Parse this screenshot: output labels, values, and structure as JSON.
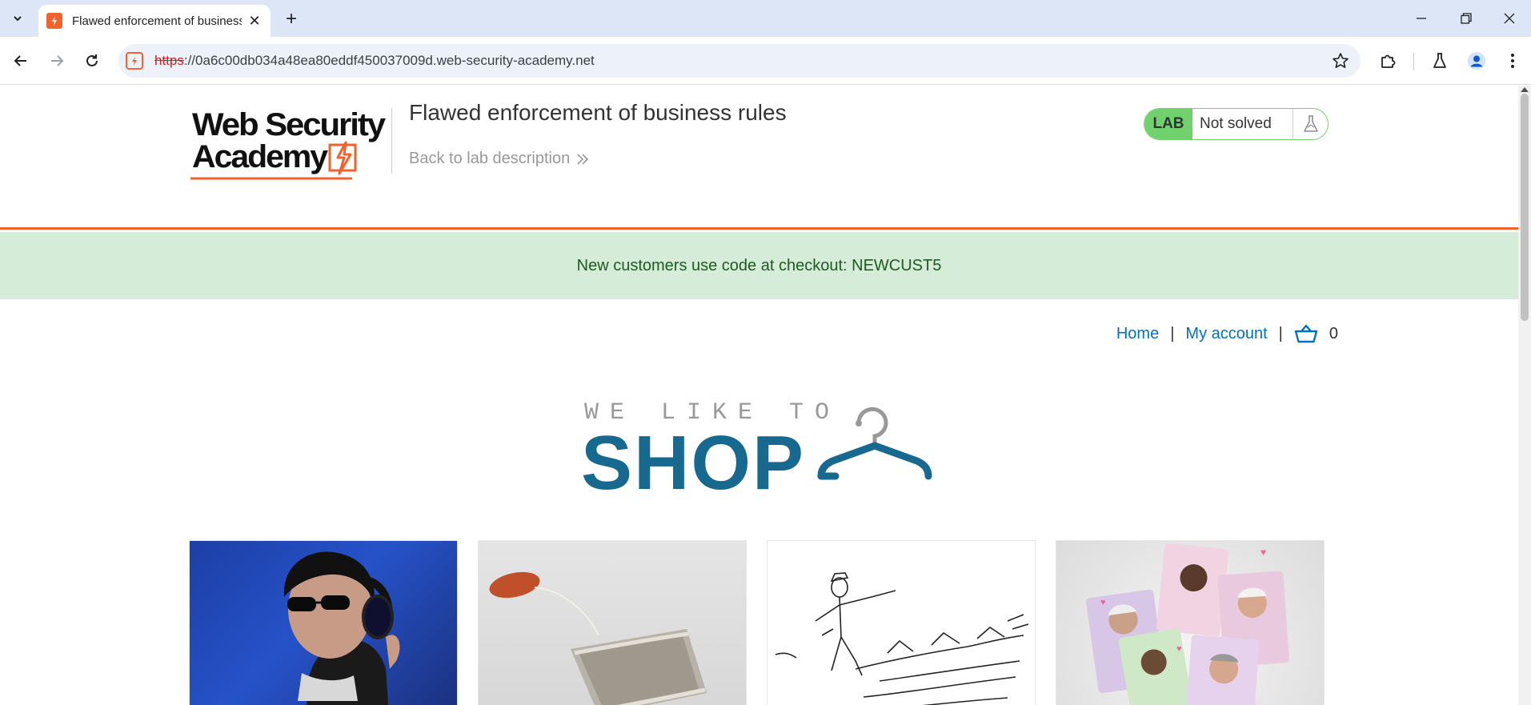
{
  "browser": {
    "tab_title": "Flawed enforcement of business rules",
    "url_scheme": "https",
    "url_rest": "://0a6c00db034a48ea80eddf450037009d.web-security-academy.net"
  },
  "header": {
    "logo_text_line1": "Web Security",
    "logo_text_line2": "Academy",
    "lab_title": "Flawed enforcement of business rules",
    "back_link": "Back to lab description",
    "status_badge": "LAB",
    "status_text": "Not solved"
  },
  "notice": {
    "text": "New customers use code at checkout: NEWCUST5"
  },
  "nav": {
    "home": "Home",
    "separator": "|",
    "my_account": "My account",
    "cart_count": "0"
  },
  "banner": {
    "tagline": "WE LIKE TO",
    "headline": "SHOP"
  },
  "colors": {
    "brand_orange": "#f0632d",
    "lab_green": "#70d16d",
    "notice_bg": "#d4ecd8",
    "link_blue": "#0071bc",
    "shop_blue": "#18698f"
  },
  "products": [
    {
      "image": "woman-with-headphones"
    },
    {
      "image": "tea-bag"
    },
    {
      "image": "line-drawing-walking-figure"
    },
    {
      "image": "politician-cards"
    }
  ]
}
